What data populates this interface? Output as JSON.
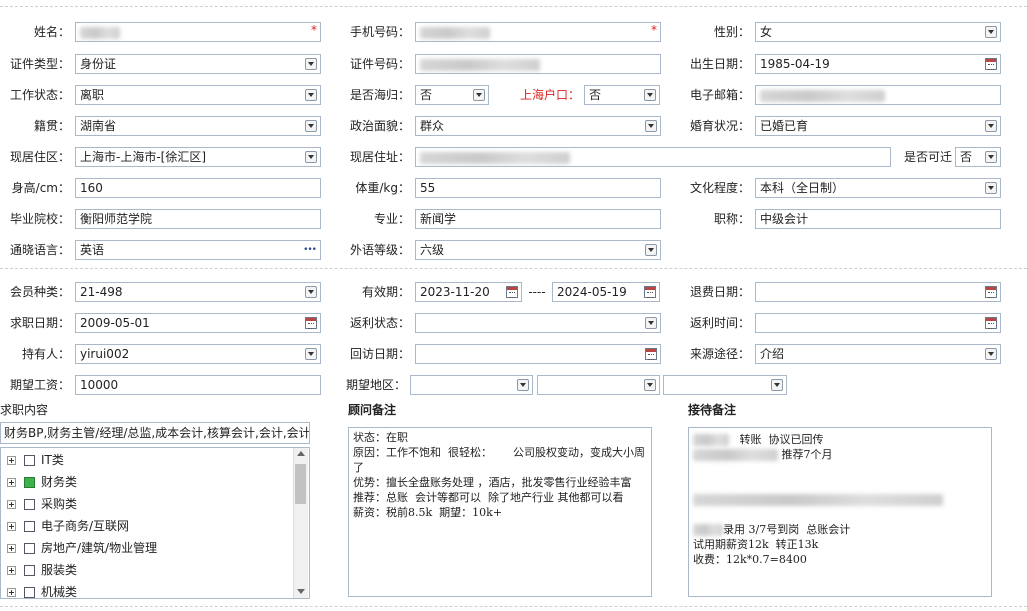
{
  "form": {
    "row1": {
      "name_label": "姓名：",
      "phone_label": "手机号码：",
      "gender_label": "性别：",
      "gender_value": "女"
    },
    "row2": {
      "idtype_label": "证件类型：",
      "idtype_value": "身份证",
      "idno_label": "证件号码：",
      "birth_label": "出生日期：",
      "birth_value": "1985-04-19"
    },
    "row3": {
      "work_label": "工作状态：",
      "work_value": "离职",
      "returnee_label": "是否海归：",
      "returnee_value": "否",
      "hukou_label": "上海户口：",
      "hukou_value": "否",
      "email_label": "电子邮箱："
    },
    "row4": {
      "native_label": "籍贯：",
      "native_value": "湖南省",
      "political_label": "政治面貌：",
      "political_value": "群众",
      "marital_label": "婚育状况：",
      "marital_value": "已婚已育"
    },
    "row5": {
      "residence_label": "现居住区：",
      "residence_value": "上海市-上海市-[徐汇区]",
      "address_label": "现居住址：",
      "movable_label": "是否可迁",
      "movable_value": "否"
    },
    "row6": {
      "height_label": "身高/cm：",
      "height_value": "160",
      "weight_label": "体重/kg：",
      "weight_value": "55",
      "edu_label": "文化程度：",
      "edu_value": "本科（全日制）"
    },
    "row7": {
      "school_label": "毕业院校：",
      "school_value": "衡阳师范学院",
      "major_label": "专业：",
      "major_value": "新闻学",
      "title_label": "职称：",
      "title_value": "中级会计"
    },
    "row8": {
      "lang_label": "通晓语言：",
      "lang_value": "英语",
      "lang_more": "•••",
      "flevel_label": "外语等级：",
      "flevel_value": "六级"
    },
    "row9": {
      "member_label": "会员种类：",
      "member_value": "21-498",
      "valid_label": "有效期：",
      "valid_from": "2023-11-20",
      "valid_sep": "----",
      "valid_to": "2024-05-19",
      "refund_label": "退费日期："
    },
    "row10": {
      "jobdate_label": "求职日期：",
      "jobdate_value": "2009-05-01",
      "rebate_status_label": "返利状态：",
      "rebate_time_label": "返利时间："
    },
    "row11": {
      "holder_label": "持有人：",
      "holder_value": "yirui002",
      "visit_label": "回访日期：",
      "source_label": "来源途径：",
      "source_value": "介绍"
    },
    "row12": {
      "salary_label": "期望工资：",
      "salary_value": "10000",
      "area_label": "期望地区："
    }
  },
  "job_panel": {
    "title": "求职内容",
    "selected_text": "财务BP,财务主管/经理/总监,成本会计,核算会计,会计,会计...",
    "items": [
      {
        "label": "IT类",
        "checked": false
      },
      {
        "label": "财务类",
        "checked": true
      },
      {
        "label": "采购类",
        "checked": false
      },
      {
        "label": "电子商务/互联网",
        "checked": false
      },
      {
        "label": "房地产/建筑/物业管理",
        "checked": false
      },
      {
        "label": "服装类",
        "checked": false
      },
      {
        "label": "机械类",
        "checked": false
      }
    ]
  },
  "advisor_panel": {
    "title": "顾问备注",
    "text": "状态：在职\n原因：工作不饱和  很轻松：      公司股权变动，变成大小周了\n优势：擅长全盘账务处理 ，酒店，批发零售行业经验丰富\n推荐：总账  会计等都可以  除了地产行业 其他都可以看\n薪资：税前8.5k  期望：10k+"
  },
  "reception_panel": {
    "title": "接待备注",
    "line1": "转账  协议已回传",
    "line2": "推荐7个月",
    "line3": "录用 3/7号到岗  总账会计",
    "line4": "试用期薪资12k  转正13k",
    "line5": "收费：12k*0.7=8400"
  }
}
